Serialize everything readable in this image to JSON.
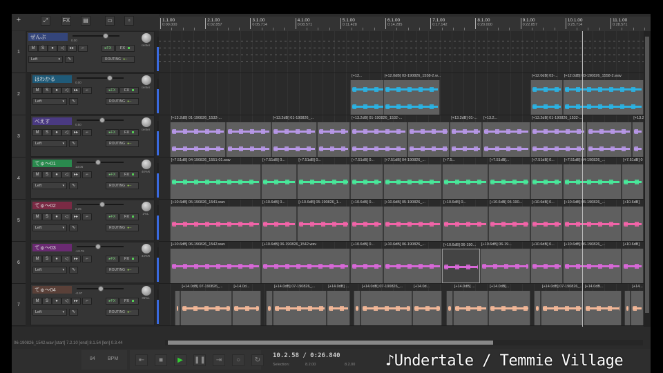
{
  "toolbar": {
    "add": "+",
    "items": [
      "envelope-icon",
      "FX",
      "mixer-icon",
      "grid-icon",
      "snap-icon"
    ]
  },
  "ruler": {
    "markers": [
      {
        "bar": "1.1.00",
        "time": "0:00.000",
        "m": 1
      },
      {
        "bar": "2.1.00",
        "time": "0:02.857",
        "m": 2
      },
      {
        "bar": "3.1.00",
        "time": "0:05.714",
        "m": 3
      },
      {
        "bar": "4.1.00",
        "time": "0:08.571",
        "m": 4
      },
      {
        "bar": "5.1.00",
        "time": "0:11.428",
        "m": 5
      },
      {
        "bar": "6.1.00",
        "time": "0:14.285",
        "m": 6
      },
      {
        "bar": "7.1.00",
        "time": "0:17.142",
        "m": 7
      },
      {
        "bar": "8.1.00",
        "time": "0:20.000",
        "m": 8
      },
      {
        "bar": "9.1.00",
        "time": "0:22.857",
        "m": 9
      },
      {
        "bar": "10.1.00",
        "time": "0:25.714",
        "m": 10
      },
      {
        "bar": "11.1.00",
        "time": "0:28.571",
        "m": 11
      }
    ]
  },
  "labels": {
    "m": "M",
    "s": "S",
    "rec": "●",
    "mon": "◁",
    "io": "▸▸",
    "env": "∿",
    "trim": "⌐",
    "infx": "▸FX",
    "fx": "FX",
    "routing": "ROUTING",
    "chan": "Left",
    "arrow": "▾"
  },
  "tracks": [
    {
      "num": "1",
      "name": "ぜんぶ",
      "color": "#34457a",
      "vol": "0.00",
      "volpos": 0.7,
      "pan": "center",
      "folder": true,
      "wave": "#888",
      "items": []
    },
    {
      "num": "2",
      "name": "ほわかる",
      "color": "#1f5a78",
      "vol": "0.00",
      "volpos": 0.7,
      "pan": "center",
      "wave": "#2ab4e6",
      "stereo": true,
      "items": [
        [
          5.22,
          7.21,
          "[+12..."
        ],
        [
          5.95,
          7.21,
          "[+12.0dB] 03-190826_1558-2.w..."
        ],
        [
          9.22,
          9.94,
          "[+12.0dB] 03-..."
        ],
        [
          9.94,
          11.74,
          "[+12.0dB] 03-190826_1558-2.wav"
        ]
      ]
    },
    {
      "num": "3",
      "name": "べえす",
      "color": "#4a3a82",
      "vol": "0.50",
      "volpos": 0.55,
      "pan": "center",
      "wave": "#b898e8",
      "stereo": true,
      "items": [
        [
          1.21,
          2.46,
          "[+13.2dB] 01-190826_1532-..."
        ],
        [
          2.46,
          3.47,
          ""
        ],
        [
          3.47,
          4.48,
          "[+13.2dB] 01-190826_..."
        ],
        [
          4.48,
          5.22,
          ""
        ],
        [
          5.22,
          6.49,
          "[+13.2dB] 01-190826_1532-..."
        ],
        [
          6.49,
          7.43,
          ""
        ],
        [
          7.43,
          8.15,
          "[+13.2dB] 01-..."
        ],
        [
          8.15,
          9.22,
          "[+13.2..."
        ],
        [
          9.22,
          10.46,
          "[+13.2dB] 01-190826_1532-..."
        ],
        [
          10.46,
          11.48,
          ""
        ],
        [
          11.48,
          11.74,
          "[+13.2"
        ]
      ]
    },
    {
      "num": "4",
      "name": "てゅ〜01",
      "color": "#2a8a4e",
      "vol": "13.06",
      "volpos": 0.45,
      "pan": "40%R",
      "wave": "#48e89a",
      "items": [
        [
          1.21,
          3.24,
          "[+7.51dB] 04-190826_1551-01.wav"
        ],
        [
          3.24,
          4.04,
          "[+7.51dB] 0..."
        ],
        [
          4.04,
          5.22,
          "[+7.51dB] 0..."
        ],
        [
          5.22,
          5.95,
          "[+7.51dB] 0..."
        ],
        [
          5.95,
          7.26,
          "[+7.51dB] 04-190826_..."
        ],
        [
          7.26,
          8.29,
          "[+7.5..."
        ],
        [
          8.29,
          9.22,
          "[+7.51dB]..."
        ],
        [
          9.22,
          9.94,
          "[+7.51dB] 0..."
        ],
        [
          9.94,
          11.25,
          "[+7.51dB] 04-190826_..."
        ],
        [
          11.25,
          11.74,
          "[+7.51dB] 0"
        ]
      ]
    },
    {
      "num": "5",
      "name": "てゅ〜02",
      "color": "#7a2a44",
      "vol": "0.25",
      "volpos": 0.55,
      "pan": "2%L",
      "wave": "#f264a8",
      "items": [
        [
          1.21,
          3.24,
          "[+10.6dB] 05-190826_1541.wav"
        ],
        [
          3.24,
          4.04,
          "[+10.6dB] 0..."
        ],
        [
          4.04,
          5.22,
          "[+10.6dB] 05-190826_1..."
        ],
        [
          5.22,
          5.95,
          "[+10.6dB] 0..."
        ],
        [
          5.95,
          7.26,
          "[+10.6dB] 05-190826_..."
        ],
        [
          7.26,
          8.29,
          "[+10.6dB] 0..."
        ],
        [
          8.29,
          9.22,
          "[+10.6dB] 05-190..."
        ],
        [
          9.22,
          9.94,
          "[+10.6dB] 0..."
        ],
        [
          9.94,
          11.25,
          "[+10.6dB] 05-190826_..."
        ],
        [
          11.25,
          11.74,
          "[+10.6dB]"
        ]
      ]
    },
    {
      "num": "6",
      "name": "てゅ〜03",
      "color": "#6a2a72",
      "vol": "-13.79",
      "volpos": 0.45,
      "pan": "44%R",
      "wave": "#d868d8",
      "items": [
        [
          1.21,
          3.24,
          "[+10.6dB] 06-190826_1542.wav"
        ],
        [
          3.24,
          5.22,
          "[+10.6dB] 06-190826_1542.wav"
        ],
        [
          5.22,
          5.95,
          "[+10.6dB] 0..."
        ],
        [
          5.95,
          7.26,
          "[+10.6dB] 06-190826_..."
        ],
        [
          7.26,
          8.1,
          "[+10.6dB] 06-190...",
          true
        ],
        [
          8.1,
          9.22,
          "[+10.6dB] 06-19..."
        ],
        [
          9.22,
          9.94,
          "[+10.6dB] 0..."
        ],
        [
          9.94,
          11.25,
          "[+10.6dB] 06-190826_..."
        ],
        [
          11.25,
          11.74,
          "[+10.6dB]"
        ]
      ]
    },
    {
      "num": "7",
      "name": "てゅ〜04",
      "color": "#5a4038",
      "vol": "-0.97",
      "volpos": 0.52,
      "pan": "36%L",
      "wave": "#f4b898",
      "items": [
        [
          1.32,
          1.45,
          ""
        ],
        [
          1.45,
          2.6,
          "[+14.0dB] 07-190826_..."
        ],
        [
          2.6,
          3.24,
          "[+14.0d..."
        ],
        [
          3.35,
          3.5,
          ""
        ],
        [
          3.5,
          4.7,
          "[+14.0dB] 07-190826_..."
        ],
        [
          4.7,
          5.22,
          "[+14.0dB] ..."
        ],
        [
          5.3,
          5.45,
          ""
        ],
        [
          5.45,
          6.6,
          "[+14.0dB] 07-190826_..."
        ],
        [
          6.6,
          7.26,
          "[+14.0d..."
        ],
        [
          7.35,
          7.5,
          ""
        ],
        [
          7.5,
          8.29,
          "[+14.0dB] ..."
        ],
        [
          8.29,
          9.22,
          "[+14.0dB]..."
        ],
        [
          9.3,
          9.45,
          ""
        ],
        [
          9.45,
          10.4,
          "[+14.0dB] 07-190826_..."
        ],
        [
          10.4,
          11.25,
          "[+14.0dB..."
        ],
        [
          11.3,
          11.45,
          ""
        ],
        [
          11.45,
          11.74,
          "[+14..."
        ]
      ]
    }
  ],
  "playhead_measure": 10.37,
  "status": "06-190826_1542.wav [start] 7.2.10 [end] 8.1.54 [len] 0.3.44",
  "hscroll_fraction": 0.68,
  "transport": {
    "bpm": "84",
    "bpm_label": "BPM",
    "buttons": [
      "⇤",
      "■",
      "▶",
      "❚❚",
      "⇥",
      "○",
      "↻"
    ],
    "time": "10.2.58 / 0:26.840",
    "selection_label": "Selection:",
    "sel_start": "8.2.00",
    "sel_end": "8.2.00"
  },
  "caption": "♪Undertale / Temmie Village"
}
